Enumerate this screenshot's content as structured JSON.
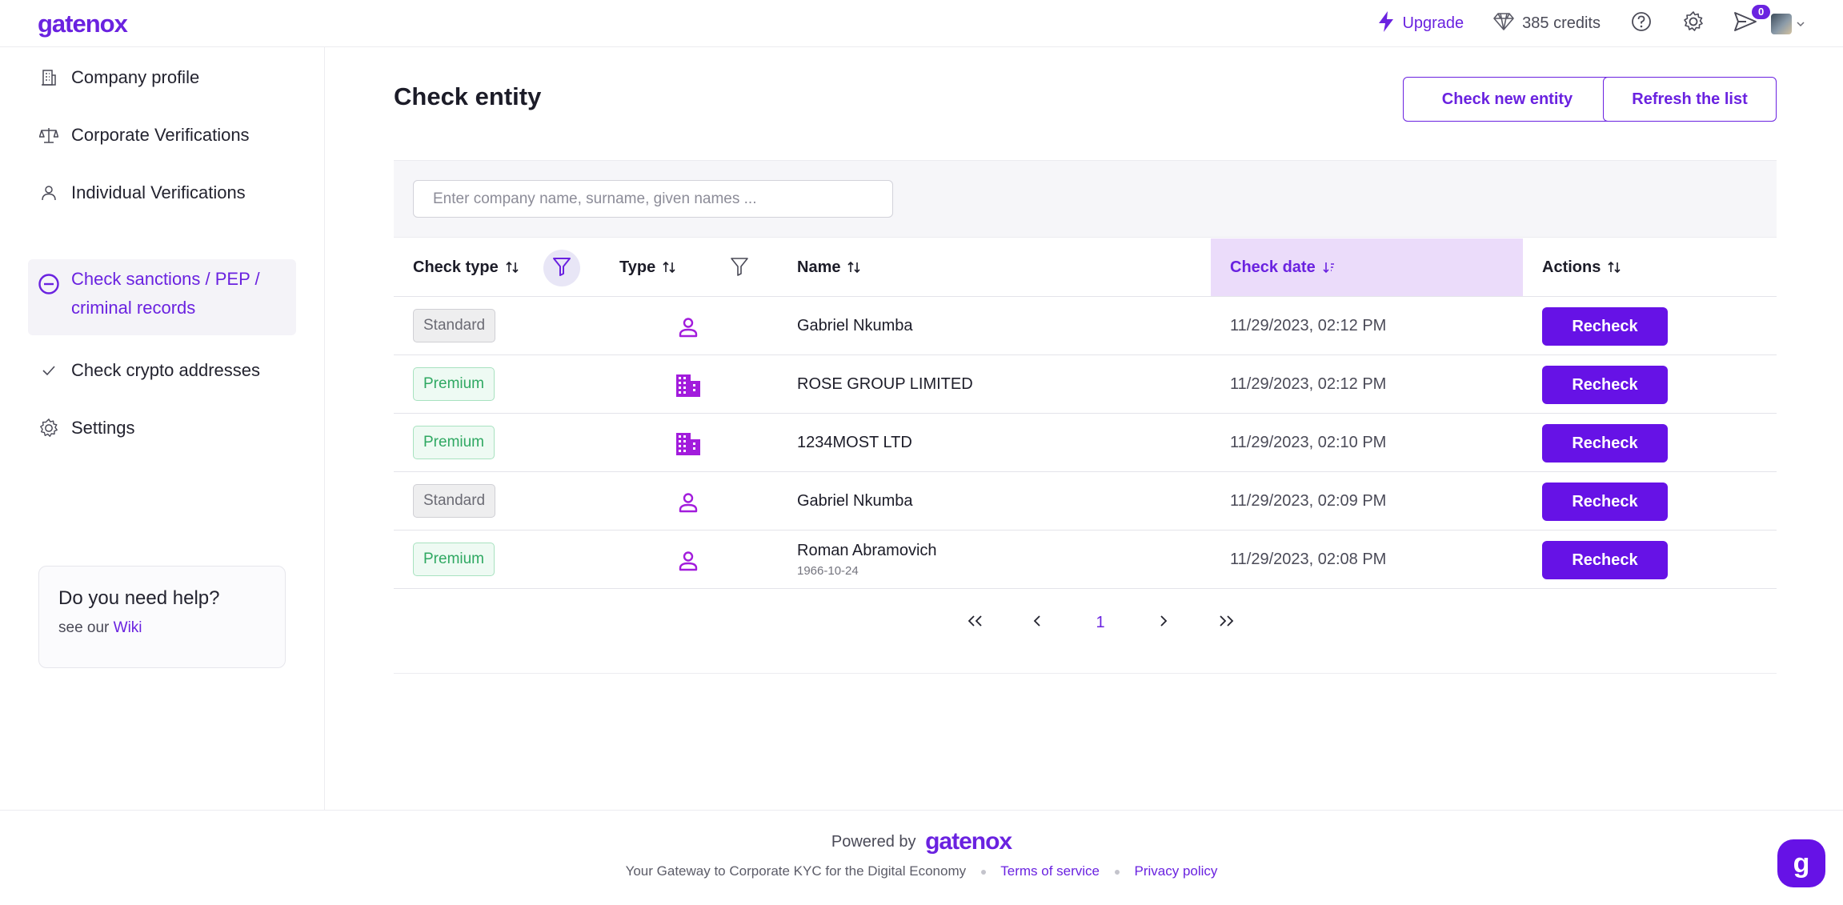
{
  "brand": {
    "logo_text": "gatenox",
    "accent_color": "#6a22e0",
    "button_color": "#6612e6"
  },
  "topbar": {
    "upgrade_label": "Upgrade",
    "upgrade_icon": "lightning-icon",
    "credits_label": "385 credits",
    "credits_icon": "diamond-icon",
    "notification_count": "0"
  },
  "sidebar": {
    "items": [
      {
        "label": "Company profile",
        "icon": "building-icon"
      },
      {
        "label": "Corporate Verifications",
        "icon": "scales-icon"
      },
      {
        "label": "Individual Verifications",
        "icon": "person-icon"
      },
      {
        "label": "Check sanctions / PEP / criminal records",
        "icon": "minus-circle-icon",
        "active": true
      },
      {
        "label": "Check crypto addresses",
        "icon": "check-icon"
      },
      {
        "label": "Settings",
        "icon": "gear-icon"
      }
    ],
    "help": {
      "title": "Do you need help?",
      "prefix": "see our",
      "link": "Wiki"
    }
  },
  "main": {
    "title": "Check entity",
    "check_new_label": "Check new entity",
    "refresh_label": "Refresh the list",
    "search_placeholder": "Enter company name, surname, given names ...",
    "columns": {
      "check_type": "Check type",
      "type": "Type",
      "name": "Name",
      "check_date": "Check date",
      "actions": "Actions"
    },
    "rows": [
      {
        "check_type": "Standard",
        "type": "person",
        "name": "Gabriel Nkumba",
        "sub": "",
        "date": "11/29/2023, 02:12 PM",
        "action": "Recheck"
      },
      {
        "check_type": "Premium",
        "type": "company",
        "name": "ROSE GROUP LIMITED",
        "sub": "",
        "date": "11/29/2023, 02:12 PM",
        "action": "Recheck"
      },
      {
        "check_type": "Premium",
        "type": "company",
        "name": "1234MOST LTD",
        "sub": "",
        "date": "11/29/2023, 02:10 PM",
        "action": "Recheck"
      },
      {
        "check_type": "Standard",
        "type": "person",
        "name": "Gabriel Nkumba",
        "sub": "",
        "date": "11/29/2023, 02:09 PM",
        "action": "Recheck"
      },
      {
        "check_type": "Premium",
        "type": "person",
        "name": "Roman Abramovich",
        "sub": "1966-10-24",
        "date": "11/29/2023, 02:08 PM",
        "action": "Recheck"
      }
    ],
    "pagination": {
      "current_page": "1"
    }
  },
  "footer": {
    "powered_prefix": "Powered by",
    "powered_logo": "gatenox",
    "tagline": "Your Gateway to Corporate KYC for the Digital Economy",
    "terms": "Terms of service",
    "privacy": "Privacy policy"
  },
  "chat": {
    "label": "g"
  }
}
